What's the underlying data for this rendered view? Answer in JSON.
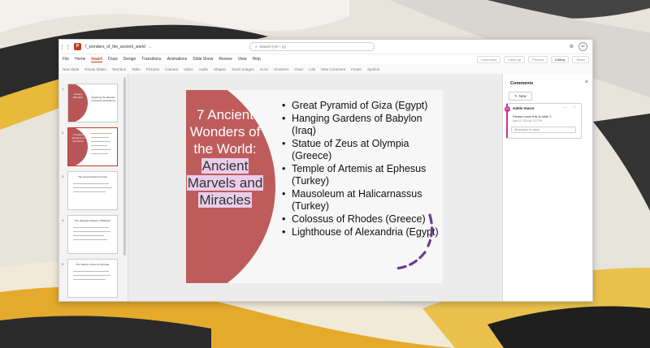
{
  "window": {
    "doc_title": "7_wonders_of_the_ancient_world",
    "search_placeholder": "Search (Alt + Q)",
    "user_initials": "AV",
    "app_logo": "P"
  },
  "menu": {
    "tabs": [
      "File",
      "Home",
      "Insert",
      "Draw",
      "Design",
      "Transitions",
      "Animations",
      "Slide Show",
      "Review",
      "View",
      "Help"
    ],
    "active_tab": "Insert",
    "right_buttons": [
      "Comments",
      "Catch up",
      "Present",
      "Editing",
      "Share"
    ]
  },
  "ribbon": {
    "items": [
      "New Slide",
      "Reuse Slides",
      "Text Box",
      "Table",
      "Pictures",
      "Camera",
      "Video",
      "Audio",
      "Shapes",
      "Stock Images",
      "Icons",
      "SmartArt",
      "Chart",
      "Link",
      "New Comment",
      "Footer",
      "Symbol"
    ]
  },
  "thumbnails": [
    {
      "number": "1",
      "title": "Ancient Wonders",
      "subtitle": "Exploring the Marvels of Ancient Civilizations"
    },
    {
      "number": "2",
      "title": "7 Ancient Wonders of the World",
      "subtitle": ""
    },
    {
      "number": "3",
      "title": "The Great Pyramid of Giza",
      "subtitle": ""
    },
    {
      "number": "4",
      "title": "The Hanging Gardens of Babylon",
      "subtitle": ""
    },
    {
      "number": "5",
      "title": "The Statue of Zeus at Olympia",
      "subtitle": ""
    }
  ],
  "slide": {
    "title_plain": "7 Ancient Wonders of the World:",
    "title_highlight_1": "Ancient",
    "title_highlight_2": "Marvels and",
    "title_highlight_3": "Miracles",
    "bullets": [
      "Great Pyramid of Giza (Egypt)",
      "Hanging Gardens of Babylon (Iraq)",
      "Statue of Zeus at Olympia (Greece)",
      "Temple of Artemis at Ephesus (Turkey)",
      "Mausoleum at Halicarnassus (Turkey)",
      "Colossus of Rhodes (Greece)",
      "Lighthouse of Alexandria (Egypt)"
    ],
    "colors": {
      "accent_shape": "#be5c5c",
      "highlight": "#eacdea",
      "ink": "#6a3d91"
    }
  },
  "comments": {
    "header": "Comments",
    "new_label": "New",
    "card": {
      "author_initials": "AV",
      "author": "Adele Vance",
      "text": "Please move this to slide 2.",
      "date": "April 23, 2024 at 1:07 PM",
      "reply_placeholder": "@mention or reply"
    }
  }
}
